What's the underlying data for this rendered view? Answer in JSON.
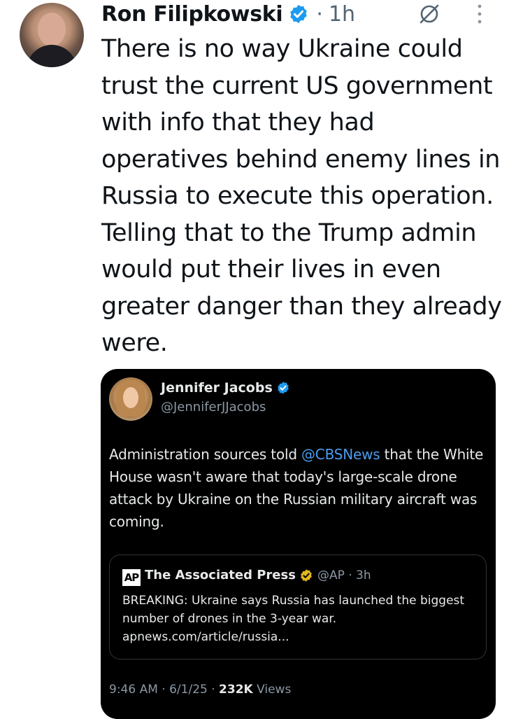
{
  "post": {
    "author_name": "Ron Filipkowski",
    "separator": "·",
    "time": "1h",
    "text": "There is no way Ukraine could trust the current US government with info that they had operatives behind enemy lines in Russia to execute this operation. Telling that to the Trump admin would put their lives in even greater danger than they already were."
  },
  "quoted_post": {
    "author_name": "Jennifer Jacobs",
    "handle": "@JenniferJJacobs",
    "text_before": "Administration sources told ",
    "mention": "@CBSNews",
    "text_after": " that the White House wasn't aware that today's large-scale drone attack by Ukraine on the Russian military aircraft was coming.",
    "meta": {
      "time": "9:46 AM",
      "sep1": " · ",
      "date": "6/1/25",
      "sep2": " · ",
      "views_count": "232K",
      "views_label": " Views"
    },
    "nested_post": {
      "logo_text": "AP",
      "author_name": "The Associated Press",
      "handle_time": "@AP · 3h",
      "text": "BREAKING: Ukraine says Russia has launched the biggest number of drones in the 3-year war. apnews.com/article/russia..."
    }
  },
  "icons": {
    "verified": "verified-badge-icon",
    "grok": "grok-icon",
    "more": "more-options-icon",
    "gold_verified": "gold-verified-badge-icon"
  },
  "colors": {
    "verified_blue": "#1d9bf0",
    "gold_badge": "#e2b719",
    "mention": "#4c9ced",
    "quote_card_bg": "#000000"
  }
}
